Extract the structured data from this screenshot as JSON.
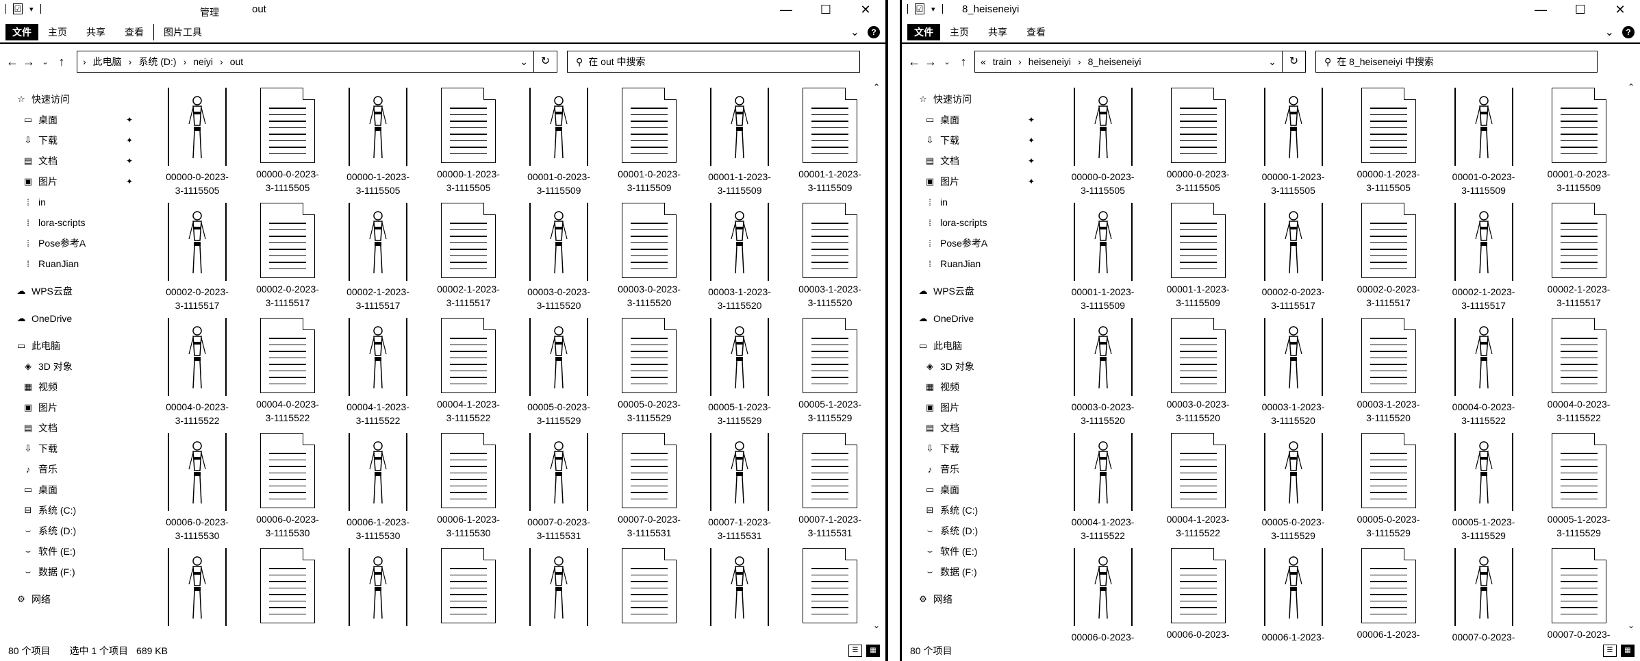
{
  "left": {
    "title_context": "管理",
    "title": "out",
    "tabs": {
      "file": "文件",
      "home": "主页",
      "share": "共享",
      "view": "查看",
      "tools": "图片工具"
    },
    "address": {
      "root": "此电脑",
      "drive": "系统 (D:)",
      "folder1": "neiyi",
      "folder2": "out"
    },
    "search_placeholder": "在 out 中搜索",
    "status": {
      "count": "80 个项目",
      "selected": "选中 1 个项目",
      "size": "689 KB"
    },
    "nav": {
      "quick": "快速访问",
      "desktop": "桌面",
      "downloads": "下载",
      "docs": "文档",
      "pics": "图片",
      "in": "in",
      "lora": "lora-scripts",
      "pose": "Pose参考A",
      "ruanjian": "RuanJian",
      "wps": "WPS云盘",
      "onedrive": "OneDrive",
      "pc": "此电脑",
      "obj3d": "3D 对象",
      "video": "视频",
      "pics2": "图片",
      "docs2": "文档",
      "downloads2": "下载",
      "music": "音乐",
      "desktop2": "桌面",
      "c": "系统 (C:)",
      "d": "系统 (D:)",
      "e": "软件 (E:)",
      "f": "数据 (F:)",
      "network": "网络"
    },
    "files": [
      {
        "l1": "00000-0-2023-",
        "l2": "3-1115505",
        "kind": "img"
      },
      {
        "l1": "00000-0-2023-",
        "l2": "3-1115505",
        "kind": "doc"
      },
      {
        "l1": "00000-1-2023-",
        "l2": "3-1115505",
        "kind": "img"
      },
      {
        "l1": "00000-1-2023-",
        "l2": "3-1115505",
        "kind": "doc"
      },
      {
        "l1": "00001-0-2023-",
        "l2": "3-1115509",
        "kind": "img"
      },
      {
        "l1": "00001-0-2023-",
        "l2": "3-1115509",
        "kind": "doc"
      },
      {
        "l1": "00001-1-2023-",
        "l2": "3-1115509",
        "kind": "img"
      },
      {
        "l1": "00001-1-2023-",
        "l2": "3-1115509",
        "kind": "doc"
      },
      {
        "l1": "00002-0-2023-",
        "l2": "3-1115517",
        "kind": "img"
      },
      {
        "l1": "00002-0-2023-",
        "l2": "3-1115517",
        "kind": "doc"
      },
      {
        "l1": "00002-1-2023-",
        "l2": "3-1115517",
        "kind": "img"
      },
      {
        "l1": "00002-1-2023-",
        "l2": "3-1115517",
        "kind": "doc"
      },
      {
        "l1": "00003-0-2023-",
        "l2": "3-1115520",
        "kind": "img"
      },
      {
        "l1": "00003-0-2023-",
        "l2": "3-1115520",
        "kind": "doc"
      },
      {
        "l1": "00003-1-2023-",
        "l2": "3-1115520",
        "kind": "img"
      },
      {
        "l1": "00003-1-2023-",
        "l2": "3-1115520",
        "kind": "doc"
      },
      {
        "l1": "00004-0-2023-",
        "l2": "3-1115522",
        "kind": "img"
      },
      {
        "l1": "00004-0-2023-",
        "l2": "3-1115522",
        "kind": "doc"
      },
      {
        "l1": "00004-1-2023-",
        "l2": "3-1115522",
        "kind": "img"
      },
      {
        "l1": "00004-1-2023-",
        "l2": "3-1115522",
        "kind": "doc"
      },
      {
        "l1": "00005-0-2023-",
        "l2": "3-1115529",
        "kind": "img"
      },
      {
        "l1": "00005-0-2023-",
        "l2": "3-1115529",
        "kind": "doc"
      },
      {
        "l1": "00005-1-2023-",
        "l2": "3-1115529",
        "kind": "img"
      },
      {
        "l1": "00005-1-2023-",
        "l2": "3-1115529",
        "kind": "doc"
      },
      {
        "l1": "00006-0-2023-",
        "l2": "3-1115530",
        "kind": "img"
      },
      {
        "l1": "00006-0-2023-",
        "l2": "3-1115530",
        "kind": "doc"
      },
      {
        "l1": "00006-1-2023-",
        "l2": "3-1115530",
        "kind": "img"
      },
      {
        "l1": "00006-1-2023-",
        "l2": "3-1115530",
        "kind": "doc"
      },
      {
        "l1": "00007-0-2023-",
        "l2": "3-1115531",
        "kind": "img"
      },
      {
        "l1": "00007-0-2023-",
        "l2": "3-1115531",
        "kind": "doc"
      },
      {
        "l1": "00007-1-2023-",
        "l2": "3-1115531",
        "kind": "img"
      },
      {
        "l1": "00007-1-2023-",
        "l2": "3-1115531",
        "kind": "doc"
      },
      {
        "l1": "",
        "l2": "",
        "kind": "img"
      },
      {
        "l1": "",
        "l2": "",
        "kind": "doc"
      },
      {
        "l1": "",
        "l2": "",
        "kind": "img"
      },
      {
        "l1": "",
        "l2": "",
        "kind": "doc"
      },
      {
        "l1": "",
        "l2": "",
        "kind": "img"
      },
      {
        "l1": "",
        "l2": "",
        "kind": "doc"
      },
      {
        "l1": "",
        "l2": "",
        "kind": "img"
      },
      {
        "l1": "",
        "l2": "",
        "kind": "doc"
      }
    ]
  },
  "right": {
    "title": "8_heiseneiyi",
    "tabs": {
      "file": "文件",
      "home": "主页",
      "share": "共享",
      "view": "查看"
    },
    "address": {
      "overflow": "«",
      "folder1": "train",
      "folder2": "heiseneiyi",
      "folder3": "8_heiseneiyi"
    },
    "search_placeholder": "在 8_heiseneiyi 中搜索",
    "status": {
      "count": "80 个项目"
    },
    "nav": {
      "quick": "快速访问",
      "desktop": "桌面",
      "downloads": "下载",
      "docs": "文档",
      "pics": "图片",
      "in": "in",
      "lora": "lora-scripts",
      "pose": "Pose参考A",
      "ruanjian": "RuanJian",
      "wps": "WPS云盘",
      "onedrive": "OneDrive",
      "pc": "此电脑",
      "obj3d": "3D 对象",
      "video": "视频",
      "pics2": "图片",
      "docs2": "文档",
      "downloads2": "下载",
      "music": "音乐",
      "desktop2": "桌面",
      "c": "系统 (C:)",
      "d": "系统 (D:)",
      "e": "软件 (E:)",
      "f": "数据 (F:)",
      "network": "网络"
    },
    "files": [
      {
        "l1": "00000-0-2023-",
        "l2": "3-1115505",
        "kind": "img"
      },
      {
        "l1": "00000-0-2023-",
        "l2": "3-1115505",
        "kind": "doc"
      },
      {
        "l1": "00000-1-2023-",
        "l2": "3-1115505",
        "kind": "img"
      },
      {
        "l1": "00000-1-2023-",
        "l2": "3-1115505",
        "kind": "doc"
      },
      {
        "l1": "00001-0-2023-",
        "l2": "3-1115509",
        "kind": "img"
      },
      {
        "l1": "00001-0-2023-",
        "l2": "3-1115509",
        "kind": "doc"
      },
      {
        "l1": "00001-1-2023-",
        "l2": "3-1115509",
        "kind": "img"
      },
      {
        "l1": "00001-1-2023-",
        "l2": "3-1115509",
        "kind": "doc"
      },
      {
        "l1": "00002-0-2023-",
        "l2": "3-1115517",
        "kind": "img"
      },
      {
        "l1": "00002-0-2023-",
        "l2": "3-1115517",
        "kind": "doc"
      },
      {
        "l1": "00002-1-2023-",
        "l2": "3-1115517",
        "kind": "img"
      },
      {
        "l1": "00002-1-2023-",
        "l2": "3-1115517",
        "kind": "doc"
      },
      {
        "l1": "00003-0-2023-",
        "l2": "3-1115520",
        "kind": "img"
      },
      {
        "l1": "00003-0-2023-",
        "l2": "3-1115520",
        "kind": "doc"
      },
      {
        "l1": "00003-1-2023-",
        "l2": "3-1115520",
        "kind": "img"
      },
      {
        "l1": "00003-1-2023-",
        "l2": "3-1115520",
        "kind": "doc"
      },
      {
        "l1": "00004-0-2023-",
        "l2": "3-1115522",
        "kind": "img"
      },
      {
        "l1": "00004-0-2023-",
        "l2": "3-1115522",
        "kind": "doc"
      },
      {
        "l1": "00004-1-2023-",
        "l2": "3-1115522",
        "kind": "img"
      },
      {
        "l1": "00004-1-2023-",
        "l2": "3-1115522",
        "kind": "doc"
      },
      {
        "l1": "00005-0-2023-",
        "l2": "3-1115529",
        "kind": "img"
      },
      {
        "l1": "00005-0-2023-",
        "l2": "3-1115529",
        "kind": "doc"
      },
      {
        "l1": "00005-1-2023-",
        "l2": "3-1115529",
        "kind": "img"
      },
      {
        "l1": "00005-1-2023-",
        "l2": "3-1115529",
        "kind": "doc"
      },
      {
        "l1": "00006-0-2023-",
        "l2": "",
        "kind": "img"
      },
      {
        "l1": "00006-0-2023-",
        "l2": "",
        "kind": "doc"
      },
      {
        "l1": "00006-1-2023-",
        "l2": "",
        "kind": "img"
      },
      {
        "l1": "00006-1-2023-",
        "l2": "",
        "kind": "doc"
      },
      {
        "l1": "00007-0-2023-",
        "l2": "",
        "kind": "img"
      },
      {
        "l1": "00007-0-2023-",
        "l2": "",
        "kind": "doc"
      }
    ]
  }
}
